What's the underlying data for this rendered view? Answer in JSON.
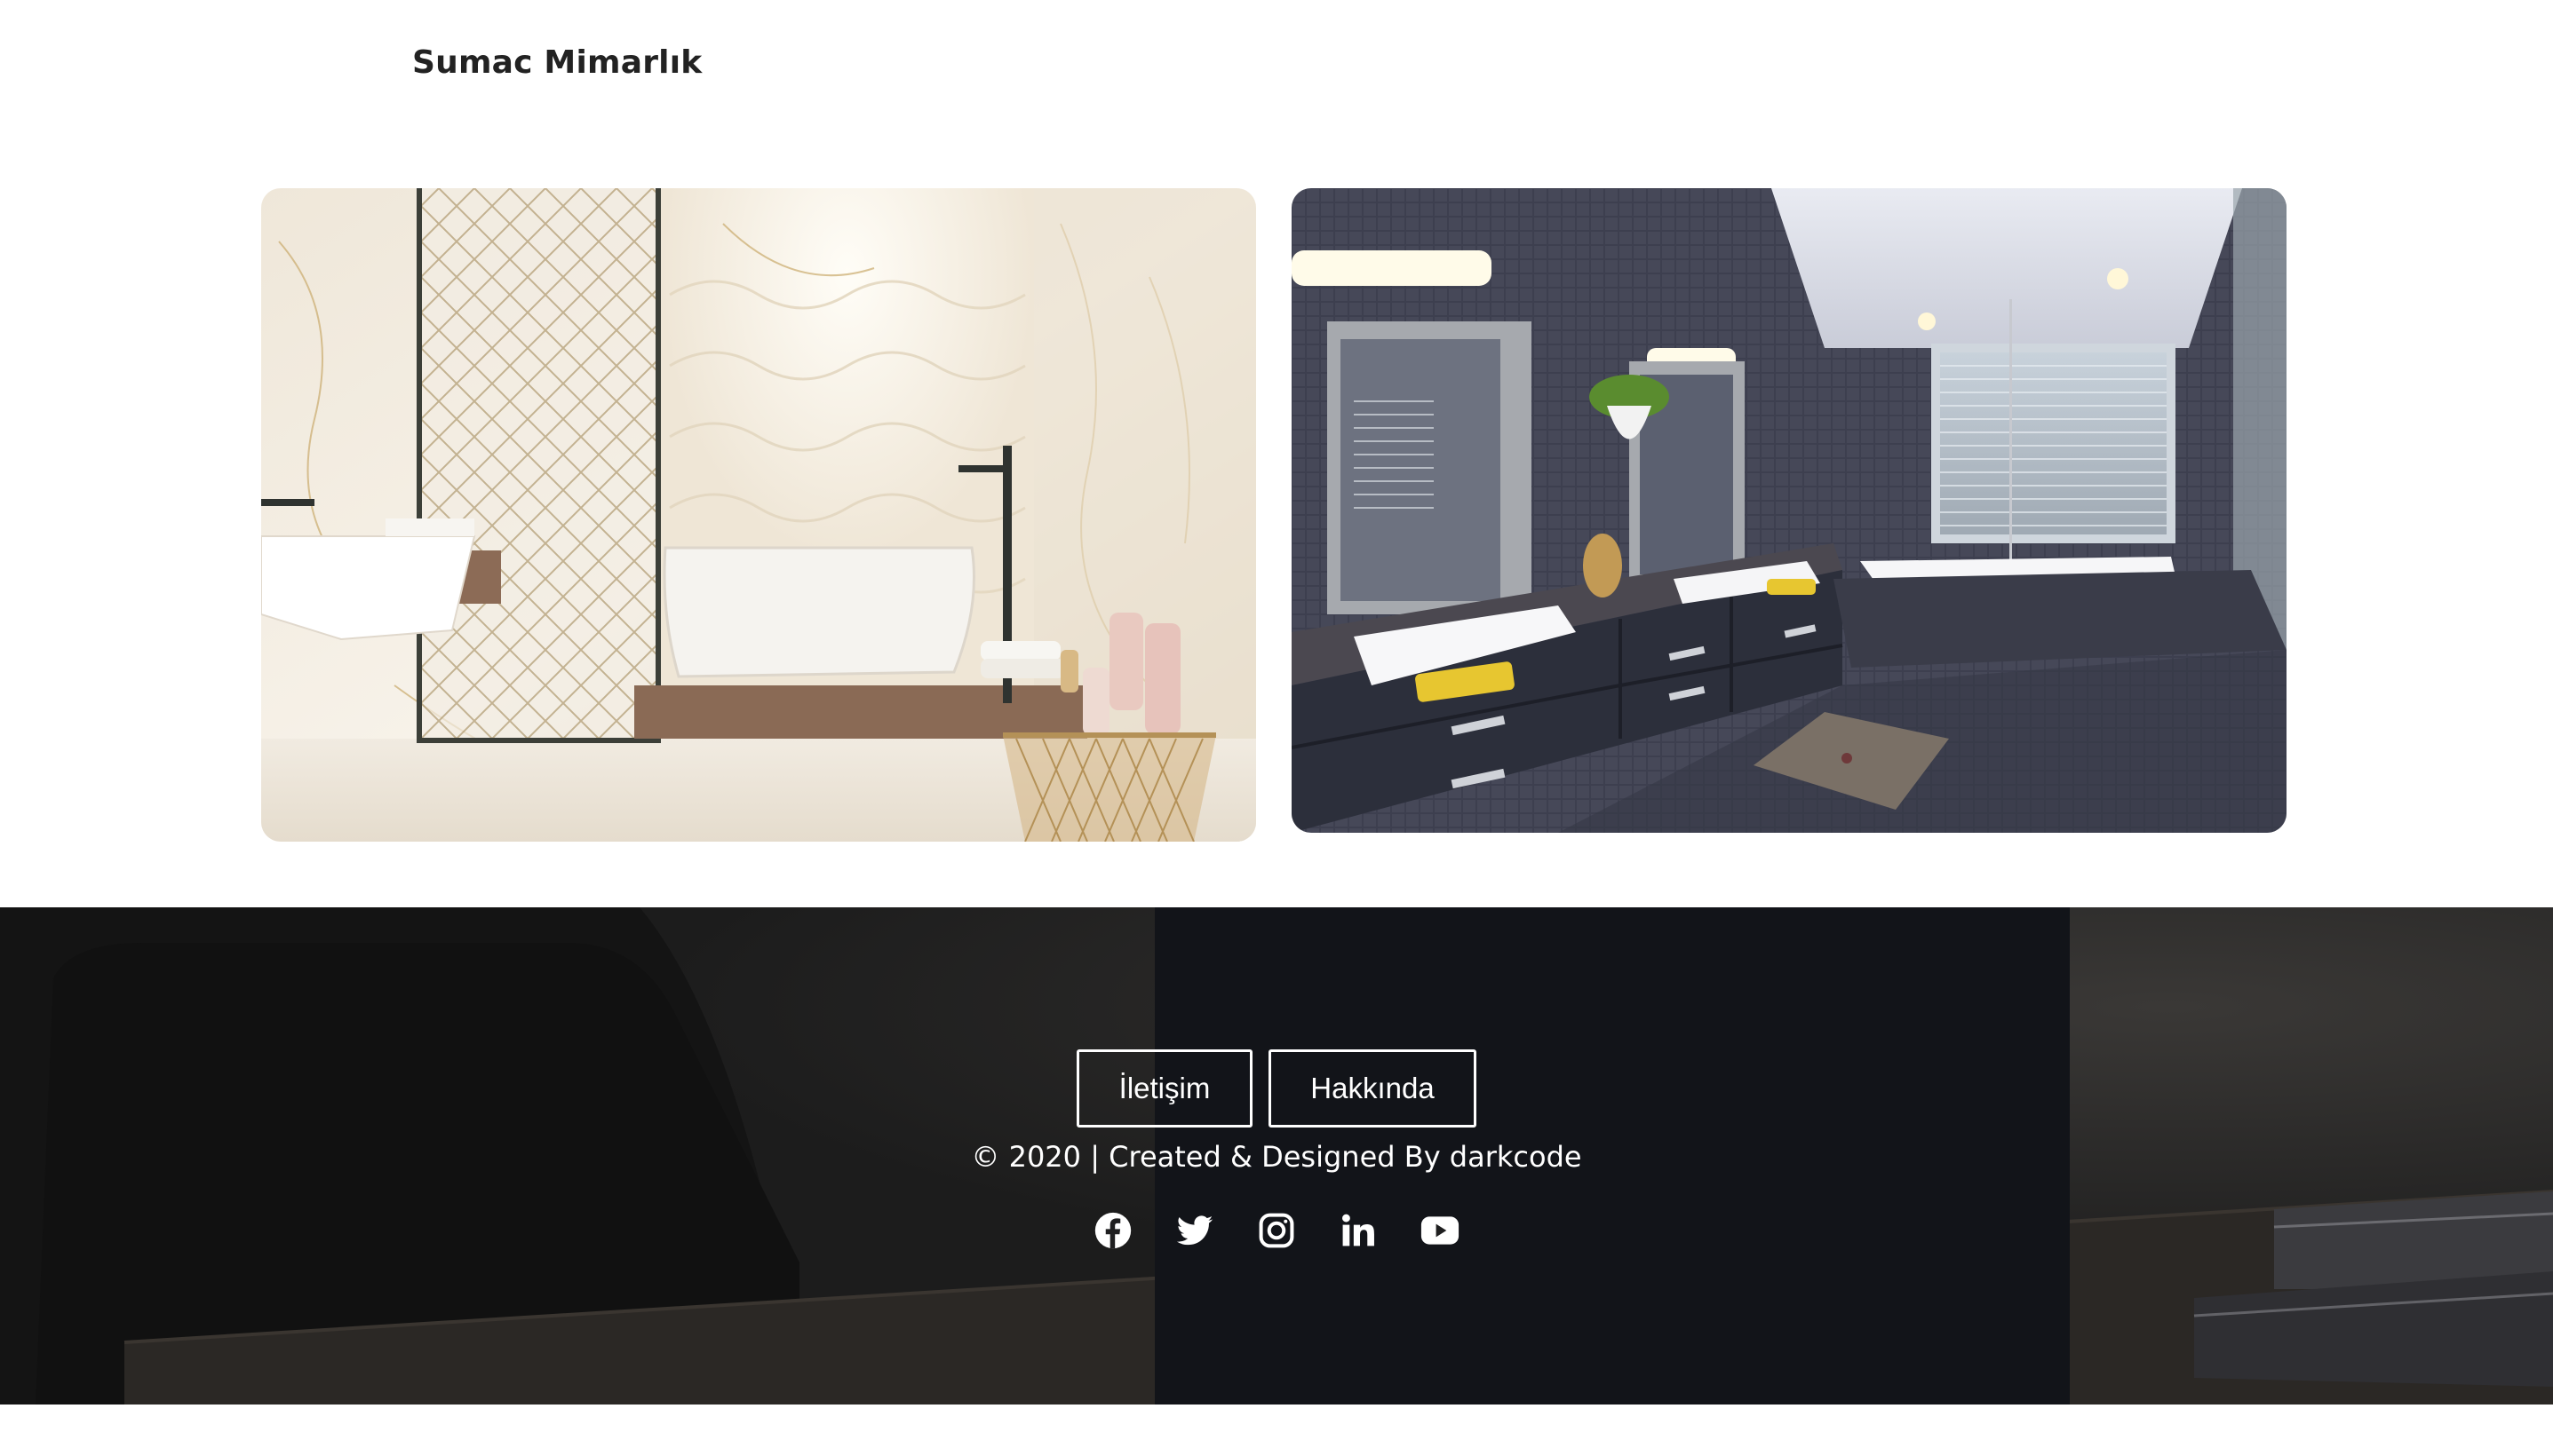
{
  "header": {
    "brand": "Sumac Mimarlık"
  },
  "gallery": {
    "images": [
      {
        "name": "marble-bathroom-image",
        "icon": "bathroom-photo"
      },
      {
        "name": "dark-tile-bathroom-image",
        "icon": "bathroom-photo"
      }
    ]
  },
  "footer": {
    "buttons": {
      "contact": "İletişim",
      "about": "Hakkında"
    },
    "copyright": "© 2020 | Created & Designed By darkcode",
    "social": [
      "facebook-icon",
      "twitter-icon",
      "instagram-icon",
      "linkedin-icon",
      "youtube-icon"
    ]
  },
  "colors": {
    "footer_bg": "#1a1a1b",
    "text_dark": "#222222",
    "text_light": "#ffffff"
  }
}
